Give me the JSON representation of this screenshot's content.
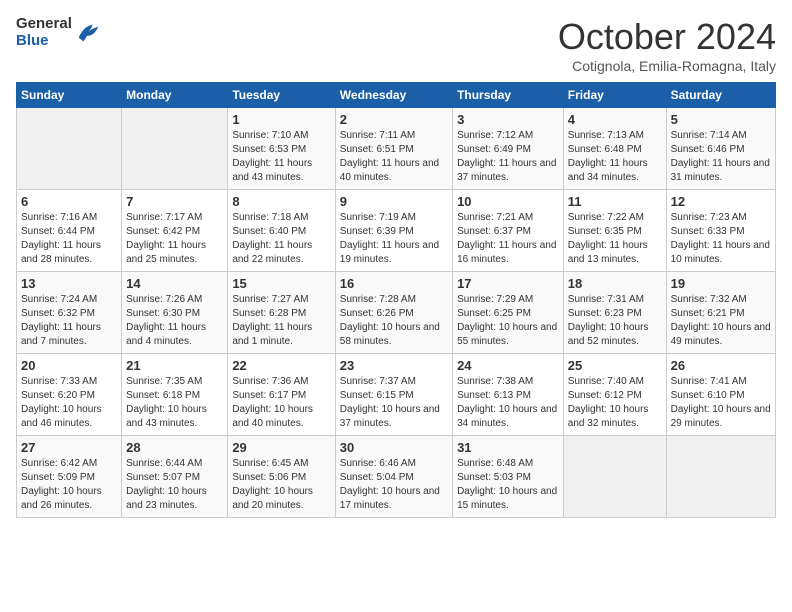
{
  "logo": {
    "general": "General",
    "blue": "Blue"
  },
  "title": "October 2024",
  "location": "Cotignola, Emilia-Romagna, Italy",
  "days_of_week": [
    "Sunday",
    "Monday",
    "Tuesday",
    "Wednesday",
    "Thursday",
    "Friday",
    "Saturday"
  ],
  "weeks": [
    [
      {
        "day": "",
        "sunrise": "",
        "sunset": "",
        "daylight": ""
      },
      {
        "day": "",
        "sunrise": "",
        "sunset": "",
        "daylight": ""
      },
      {
        "day": "1",
        "sunrise": "Sunrise: 7:10 AM",
        "sunset": "Sunset: 6:53 PM",
        "daylight": "Daylight: 11 hours and 43 minutes."
      },
      {
        "day": "2",
        "sunrise": "Sunrise: 7:11 AM",
        "sunset": "Sunset: 6:51 PM",
        "daylight": "Daylight: 11 hours and 40 minutes."
      },
      {
        "day": "3",
        "sunrise": "Sunrise: 7:12 AM",
        "sunset": "Sunset: 6:49 PM",
        "daylight": "Daylight: 11 hours and 37 minutes."
      },
      {
        "day": "4",
        "sunrise": "Sunrise: 7:13 AM",
        "sunset": "Sunset: 6:48 PM",
        "daylight": "Daylight: 11 hours and 34 minutes."
      },
      {
        "day": "5",
        "sunrise": "Sunrise: 7:14 AM",
        "sunset": "Sunset: 6:46 PM",
        "daylight": "Daylight: 11 hours and 31 minutes."
      }
    ],
    [
      {
        "day": "6",
        "sunrise": "Sunrise: 7:16 AM",
        "sunset": "Sunset: 6:44 PM",
        "daylight": "Daylight: 11 hours and 28 minutes."
      },
      {
        "day": "7",
        "sunrise": "Sunrise: 7:17 AM",
        "sunset": "Sunset: 6:42 PM",
        "daylight": "Daylight: 11 hours and 25 minutes."
      },
      {
        "day": "8",
        "sunrise": "Sunrise: 7:18 AM",
        "sunset": "Sunset: 6:40 PM",
        "daylight": "Daylight: 11 hours and 22 minutes."
      },
      {
        "day": "9",
        "sunrise": "Sunrise: 7:19 AM",
        "sunset": "Sunset: 6:39 PM",
        "daylight": "Daylight: 11 hours and 19 minutes."
      },
      {
        "day": "10",
        "sunrise": "Sunrise: 7:21 AM",
        "sunset": "Sunset: 6:37 PM",
        "daylight": "Daylight: 11 hours and 16 minutes."
      },
      {
        "day": "11",
        "sunrise": "Sunrise: 7:22 AM",
        "sunset": "Sunset: 6:35 PM",
        "daylight": "Daylight: 11 hours and 13 minutes."
      },
      {
        "day": "12",
        "sunrise": "Sunrise: 7:23 AM",
        "sunset": "Sunset: 6:33 PM",
        "daylight": "Daylight: 11 hours and 10 minutes."
      }
    ],
    [
      {
        "day": "13",
        "sunrise": "Sunrise: 7:24 AM",
        "sunset": "Sunset: 6:32 PM",
        "daylight": "Daylight: 11 hours and 7 minutes."
      },
      {
        "day": "14",
        "sunrise": "Sunrise: 7:26 AM",
        "sunset": "Sunset: 6:30 PM",
        "daylight": "Daylight: 11 hours and 4 minutes."
      },
      {
        "day": "15",
        "sunrise": "Sunrise: 7:27 AM",
        "sunset": "Sunset: 6:28 PM",
        "daylight": "Daylight: 11 hours and 1 minute."
      },
      {
        "day": "16",
        "sunrise": "Sunrise: 7:28 AM",
        "sunset": "Sunset: 6:26 PM",
        "daylight": "Daylight: 10 hours and 58 minutes."
      },
      {
        "day": "17",
        "sunrise": "Sunrise: 7:29 AM",
        "sunset": "Sunset: 6:25 PM",
        "daylight": "Daylight: 10 hours and 55 minutes."
      },
      {
        "day": "18",
        "sunrise": "Sunrise: 7:31 AM",
        "sunset": "Sunset: 6:23 PM",
        "daylight": "Daylight: 10 hours and 52 minutes."
      },
      {
        "day": "19",
        "sunrise": "Sunrise: 7:32 AM",
        "sunset": "Sunset: 6:21 PM",
        "daylight": "Daylight: 10 hours and 49 minutes."
      }
    ],
    [
      {
        "day": "20",
        "sunrise": "Sunrise: 7:33 AM",
        "sunset": "Sunset: 6:20 PM",
        "daylight": "Daylight: 10 hours and 46 minutes."
      },
      {
        "day": "21",
        "sunrise": "Sunrise: 7:35 AM",
        "sunset": "Sunset: 6:18 PM",
        "daylight": "Daylight: 10 hours and 43 minutes."
      },
      {
        "day": "22",
        "sunrise": "Sunrise: 7:36 AM",
        "sunset": "Sunset: 6:17 PM",
        "daylight": "Daylight: 10 hours and 40 minutes."
      },
      {
        "day": "23",
        "sunrise": "Sunrise: 7:37 AM",
        "sunset": "Sunset: 6:15 PM",
        "daylight": "Daylight: 10 hours and 37 minutes."
      },
      {
        "day": "24",
        "sunrise": "Sunrise: 7:38 AM",
        "sunset": "Sunset: 6:13 PM",
        "daylight": "Daylight: 10 hours and 34 minutes."
      },
      {
        "day": "25",
        "sunrise": "Sunrise: 7:40 AM",
        "sunset": "Sunset: 6:12 PM",
        "daylight": "Daylight: 10 hours and 32 minutes."
      },
      {
        "day": "26",
        "sunrise": "Sunrise: 7:41 AM",
        "sunset": "Sunset: 6:10 PM",
        "daylight": "Daylight: 10 hours and 29 minutes."
      }
    ],
    [
      {
        "day": "27",
        "sunrise": "Sunrise: 6:42 AM",
        "sunset": "Sunset: 5:09 PM",
        "daylight": "Daylight: 10 hours and 26 minutes."
      },
      {
        "day": "28",
        "sunrise": "Sunrise: 6:44 AM",
        "sunset": "Sunset: 5:07 PM",
        "daylight": "Daylight: 10 hours and 23 minutes."
      },
      {
        "day": "29",
        "sunrise": "Sunrise: 6:45 AM",
        "sunset": "Sunset: 5:06 PM",
        "daylight": "Daylight: 10 hours and 20 minutes."
      },
      {
        "day": "30",
        "sunrise": "Sunrise: 6:46 AM",
        "sunset": "Sunset: 5:04 PM",
        "daylight": "Daylight: 10 hours and 17 minutes."
      },
      {
        "day": "31",
        "sunrise": "Sunrise: 6:48 AM",
        "sunset": "Sunset: 5:03 PM",
        "daylight": "Daylight: 10 hours and 15 minutes."
      },
      {
        "day": "",
        "sunrise": "",
        "sunset": "",
        "daylight": ""
      },
      {
        "day": "",
        "sunrise": "",
        "sunset": "",
        "daylight": ""
      }
    ]
  ]
}
